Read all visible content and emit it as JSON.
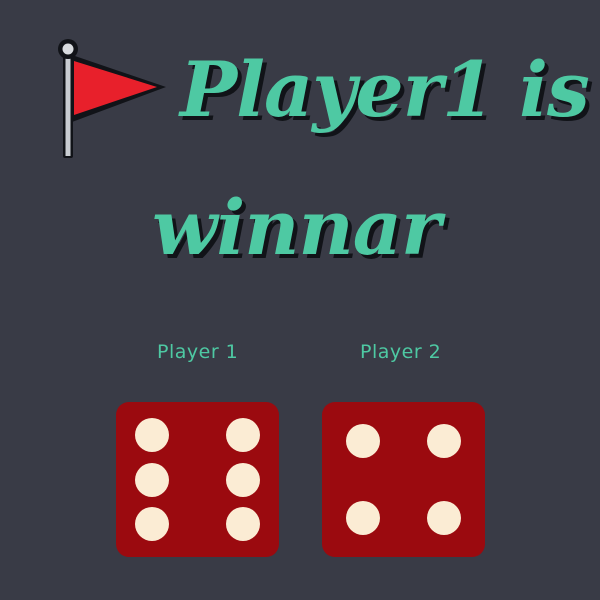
{
  "title": {
    "line1": "Player1 is",
    "line2": "winnar",
    "icon": "red-flag-icon"
  },
  "players": [
    {
      "label": "Player 1",
      "die_value": 6
    },
    {
      "label": "Player 2",
      "die_value": 4
    }
  ],
  "colors": {
    "background": "#393b46",
    "accent": "#4ec9a3",
    "die": "#9b0a0f",
    "pip": "#fbecd4",
    "flag": "#e8202b"
  }
}
